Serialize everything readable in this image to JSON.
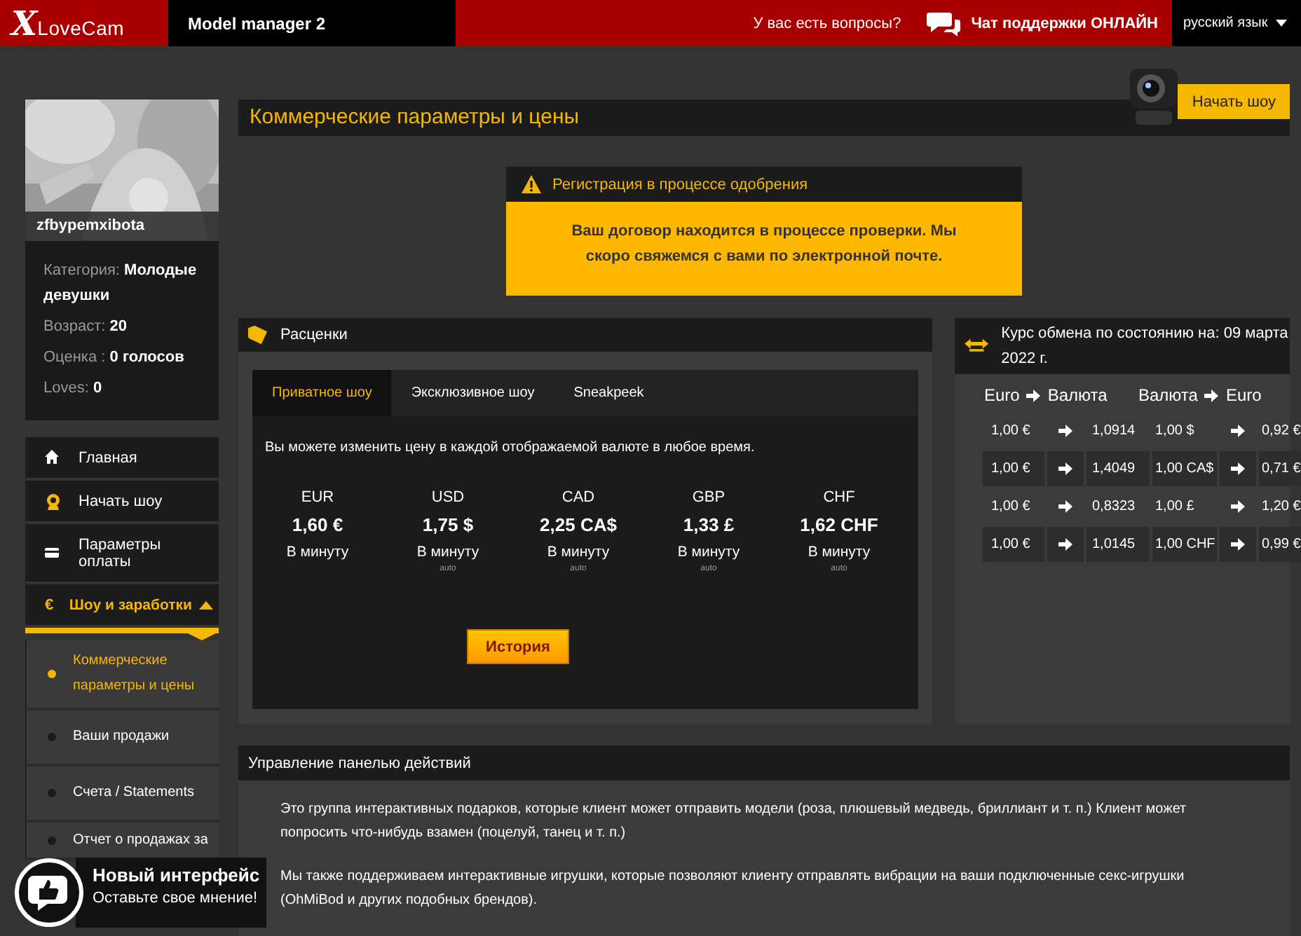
{
  "topbar": {
    "logo": "LoveCam",
    "logo_initial": "X",
    "section": "Model manager 2",
    "question": "У вас есть вопросы?",
    "chat": "Чат поддержки ОНЛАЙН",
    "language": "русский язык"
  },
  "profile": {
    "kind": "picture",
    "username": "zfbypemxibota",
    "facts": [
      {
        "label": "Категория:",
        "value": "Молодые девушки"
      },
      {
        "label": "Возраст:",
        "value": "20"
      },
      {
        "label": "Оценка :",
        "value": "0 голосов"
      },
      {
        "label": "Loves:",
        "value": "0"
      }
    ]
  },
  "menu": [
    {
      "label": "Главная",
      "selected": false
    },
    {
      "label": "Начать шоу",
      "selected": false
    },
    {
      "label": "Параметры оплаты",
      "selected": false
    },
    {
      "label": "Шоу и заработки",
      "icon": "€",
      "selected": true,
      "expanded": true,
      "children": [
        {
          "label": "Коммерческие параметры и цены",
          "selected": true
        },
        {
          "label": "Ваши продажи",
          "selected": false
        },
        {
          "label": "Счета / Statements",
          "selected": false
        },
        {
          "label": "Отчет о продажах за",
          "selected": false
        }
      ]
    }
  ],
  "page_title": "Коммерческие параметры и цены",
  "start_show_button": "Начать шоу",
  "alert": {
    "title": "Регистрация в процессе одобрения",
    "message": "Ваш договор находится в процессе проверки. Мы скоро свяжемся с вами по электронной почте."
  },
  "rates": {
    "title": "Расценки",
    "tabs": [
      {
        "label": "Приватное шоу",
        "selected": true
      },
      {
        "label": "Эксклюзивное шоу",
        "selected": false
      },
      {
        "label": "Sneakpeek",
        "selected": false
      }
    ],
    "hint": "Вы можете изменить цену в каждой отображаемой валюте в любое время.",
    "currencies": [
      {
        "code": "EUR",
        "price": "1,60 €",
        "unit": "В минуту"
      },
      {
        "code": "USD",
        "price": "1,75 $",
        "unit": "В минуту",
        "note": "auto"
      },
      {
        "code": "CAD",
        "price": "2,25 CA$",
        "unit": "В минуту",
        "note": "auto"
      },
      {
        "code": "GBP",
        "price": "1,33 £",
        "unit": "В минуту",
        "note": "auto"
      },
      {
        "code": "CHF",
        "price": "1,62 CHF",
        "unit": "В минуту",
        "note": "auto"
      }
    ],
    "history_button": "История"
  },
  "exchange": {
    "title": "Курс обмена по состоянию на: 09 марта 2022 г.",
    "headers": [
      {
        "from": "Euro",
        "to": "Валюта"
      },
      {
        "from": "Валюта",
        "to": "Euro"
      }
    ],
    "rows": [
      {
        "from": "1,00 €",
        "rate": "1,0914",
        "currency": "1,00 $",
        "back": "0,92 €"
      },
      {
        "from": "1,00 €",
        "rate": "1,4049",
        "currency": "1,00 CA$",
        "back": "0,71 €"
      },
      {
        "from": "1,00 €",
        "rate": "0,8323",
        "currency": "1,00 £",
        "back": "1,20 €"
      },
      {
        "from": "1,00 €",
        "rate": "1,0145",
        "currency": "1,00 CHF",
        "back": "0,99 €"
      }
    ]
  },
  "actions_panel": {
    "title": "Управление панелью действий",
    "paragraphs": [
      "Это группа интерактивных подарков, которые клиент может отправить модели (роза, плюшевый медведь, бриллиант и т. п.) Клиент может попросить что-нибудь взамен (поцелуй, танец и т. п.)",
      "Мы также поддерживаем интерактивные игрушки, которые позволяют клиенту отправлять вибрации на ваши подключенные секс-игрушки (OhMiBod и других подобных брендов)."
    ]
  },
  "feedback": {
    "title": "Новый интерфейс",
    "subtitle": "Оставьте свое мнение!"
  }
}
